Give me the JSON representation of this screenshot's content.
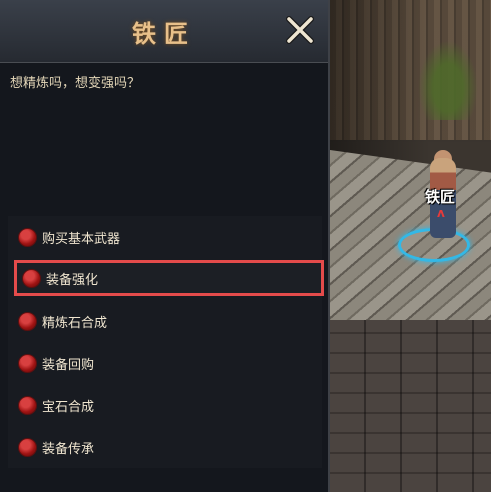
{
  "dialog": {
    "title": "铁匠",
    "prompt": "想精炼吗，想变强吗？",
    "options": [
      {
        "label": "购买基本武器"
      },
      {
        "label": "装备强化",
        "selected": true
      },
      {
        "label": "精炼石合成"
      },
      {
        "label": "装备回购"
      },
      {
        "label": "宝石合成"
      },
      {
        "label": "装备传承"
      }
    ]
  },
  "npc": {
    "name": "铁匠"
  },
  "colors": {
    "title": "#e8c08a",
    "selection_outline": "#e44b4b",
    "npc_ring": "#33b8e6",
    "option_dot": "#b01818"
  },
  "icons": {
    "close": "close-x-icon",
    "option_bullet": "red-orb-icon"
  }
}
